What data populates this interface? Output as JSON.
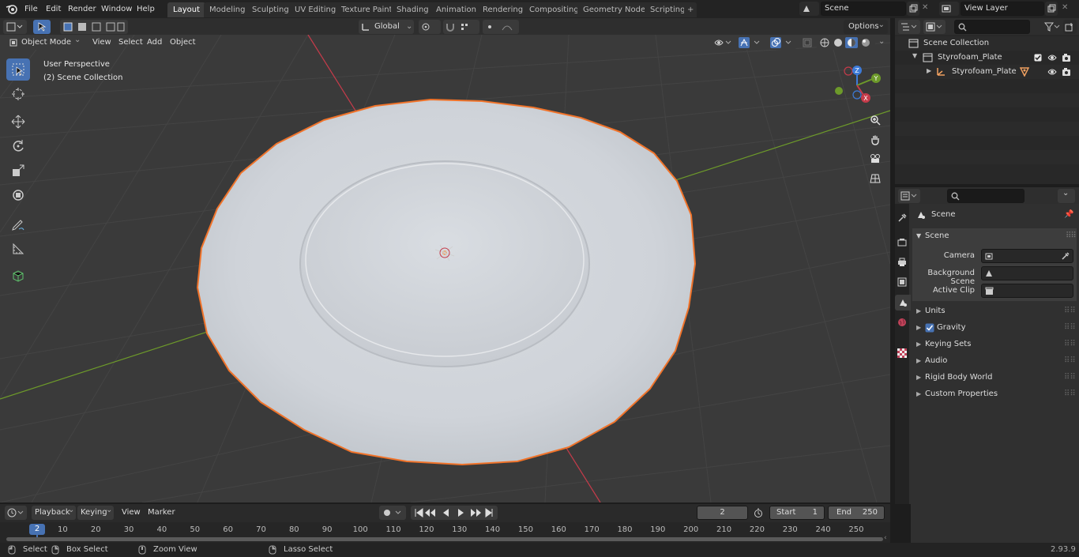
{
  "topbar": {
    "menus": [
      "File",
      "Edit",
      "Render",
      "Window",
      "Help"
    ],
    "workspaces": [
      "Layout",
      "Modeling",
      "Sculpting",
      "UV Editing",
      "Texture Paint",
      "Shading",
      "Animation",
      "Rendering",
      "Compositing",
      "Geometry Nodes",
      "Scripting"
    ],
    "active_workspace": "Layout",
    "scene_name": "Scene",
    "view_layer": "View Layer"
  },
  "viewport_header": {
    "mode": "Object Mode",
    "menus": [
      "View",
      "Select",
      "Add",
      "Object"
    ],
    "transform_orientation": "Global",
    "options_label": "Options"
  },
  "viewport": {
    "perspective_label": "User Perspective",
    "collection_label": "(2) Scene Collection",
    "gizmo_axes": {
      "x": "X",
      "y": "Y",
      "z": "Z"
    }
  },
  "outliner": {
    "root": "Scene Collection",
    "collection": "Styrofoam_Plate",
    "object": "Styrofoam_Plate"
  },
  "properties": {
    "context": "Scene",
    "panel": "Scene",
    "fields": {
      "camera_label": "Camera",
      "background_label": "Background Scene",
      "clip_label": "Active Clip"
    },
    "subpanels": [
      "Units",
      "Gravity",
      "Keying Sets",
      "Audio",
      "Rigid Body World",
      "Custom Properties"
    ]
  },
  "timeline": {
    "menus": [
      "Playback",
      "Keying",
      "View",
      "Marker"
    ],
    "current_frame": "2",
    "start_label": "Start",
    "start_value": "1",
    "end_label": "End",
    "end_value": "250",
    "ruler": [
      "10",
      "20",
      "30",
      "40",
      "50",
      "60",
      "70",
      "80",
      "90",
      "100",
      "110",
      "120",
      "130",
      "140",
      "150",
      "160",
      "170",
      "180",
      "190",
      "200",
      "210",
      "220",
      "230",
      "240",
      "250"
    ],
    "playhead": "2"
  },
  "statusbar": {
    "select": "Select",
    "box_select": "Box Select",
    "zoom_view": "Zoom View",
    "lasso_select": "Lasso Select",
    "version": "2.93.9"
  },
  "colors": {
    "accent": "#4772b3",
    "selection_outline": "#f0732a",
    "x_axis": "#c53b4a",
    "y_axis": "#6d9a2a",
    "z_axis": "#3d7bd9"
  }
}
